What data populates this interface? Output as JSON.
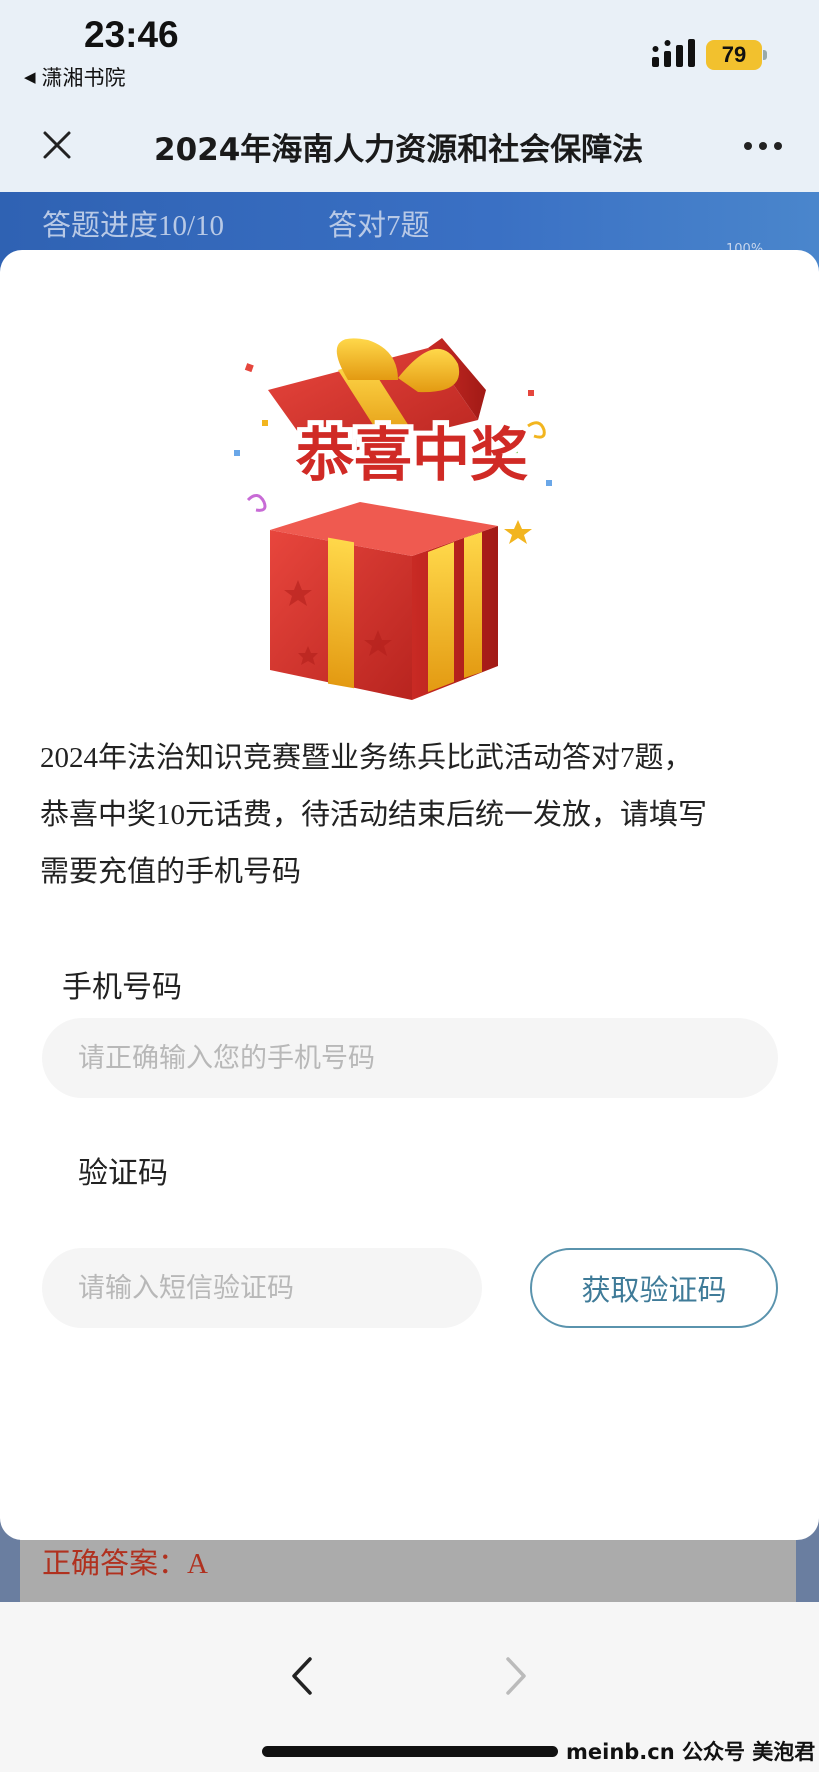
{
  "status_bar": {
    "time": "23:46",
    "back_app": "潇湘书院",
    "battery": "79"
  },
  "nav": {
    "title": "2024年海南人力资源和社会保障法"
  },
  "background": {
    "progress": "答题进度10/10",
    "correct_count": "答对7题",
    "percent": "100%",
    "answer": "正确答案：A"
  },
  "modal": {
    "gift_text": "恭喜中奖",
    "message_lines": [
      "2024年法治知识竞赛暨业务练兵比武活动答对7题，",
      "恭喜中奖10元话费，待活动结束后统一发放，请填写",
      "需要充值的手机号码"
    ],
    "phone_label": "手机号码",
    "phone_placeholder": "请正确输入您的手机号码",
    "code_label": "验证码",
    "code_placeholder": "请输入短信验证码",
    "get_code_button": "获取验证码"
  },
  "watermark": "meinb.cn 公众号 美泡君",
  "colors": {
    "header_blue": "#3a70c4",
    "button_border": "#5a93ad",
    "answer_red": "#b0311f",
    "gift_red": "#d9302a",
    "ribbon_gold": "#f2b51f"
  },
  "icons": [
    "close-icon",
    "more-icon",
    "back-arrow-icon",
    "forward-arrow-icon",
    "signal-icon",
    "battery-icon",
    "gift-box-icon"
  ]
}
